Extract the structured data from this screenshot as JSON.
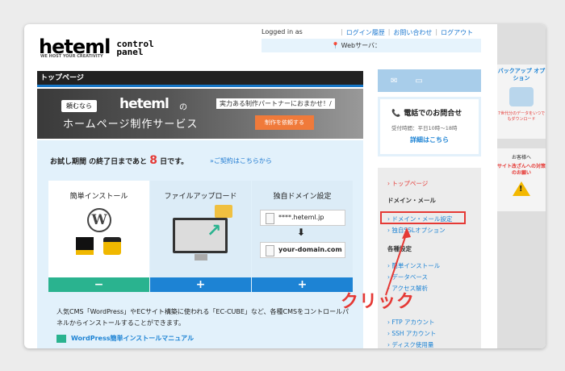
{
  "header": {
    "logo_main": "heteml",
    "logo_sub": "WE HOST YOUR CREATIVITY",
    "logo_cp": "control panel",
    "logged_in": "Logged in as",
    "links": [
      "ログイン履歴",
      "お問い合わせ",
      "ログアウト"
    ],
    "webserver": "Webサーバ："
  },
  "main": {
    "title": "トップページ",
    "banner": {
      "tag": "頼むなら",
      "logo": "heteml",
      "no": "の",
      "headline": "ホームページ制作サービス",
      "copy": "実力ある制作パートナーにおまかせ！/",
      "button": "制作を依頼する"
    },
    "trial": {
      "prefix": "お試し期間 の終了日まであと ",
      "days": "8",
      "suffix": " 日です。",
      "contract_link": "»ご契約はこちらから"
    },
    "features": [
      {
        "title": "簡単インストール",
        "button": "−"
      },
      {
        "title": "ファイルアップロード",
        "button": "+"
      },
      {
        "title": "独自ドメイン設定",
        "button": "+"
      }
    ],
    "domain_example_1": "****.heteml.jp",
    "domain_example_2": "your-domain.com",
    "description": "人気CMS「WordPress」やECサイト構築に使われる「EC-CUBE」など、各種CMSをコントロールパネルからインストールすることができます。",
    "manual_link": "WordPress簡単インストールマニュアル"
  },
  "sidebar": {
    "contact_title": "電話でのお問合せ",
    "contact_hours": "受付時間：平日10時〜18時",
    "contact_link": "詳細はこちら",
    "nav_top": "› トップページ",
    "section_domain": "ドメイン・メール",
    "domain_items": [
      "› ドメイン・メール設定",
      "› 独自SSLオプション"
    ],
    "section_settings": "各種設定",
    "settings_items": [
      "› 簡単インストール",
      "› データベース",
      "› アクセス解析",
      "› FTP アカウント",
      "› SSH アカウント",
      "› ディスク使用量"
    ]
  },
  "ads": {
    "backup_title": "バックアップ オプション",
    "backup_note": "7世代分のデータをいつでもダウンロード",
    "warn_top": "お客様へ",
    "warn_title": "サイト改ざんへの対策のお願い"
  },
  "annotation": {
    "click": "クリック",
    "color": "#e53935"
  }
}
